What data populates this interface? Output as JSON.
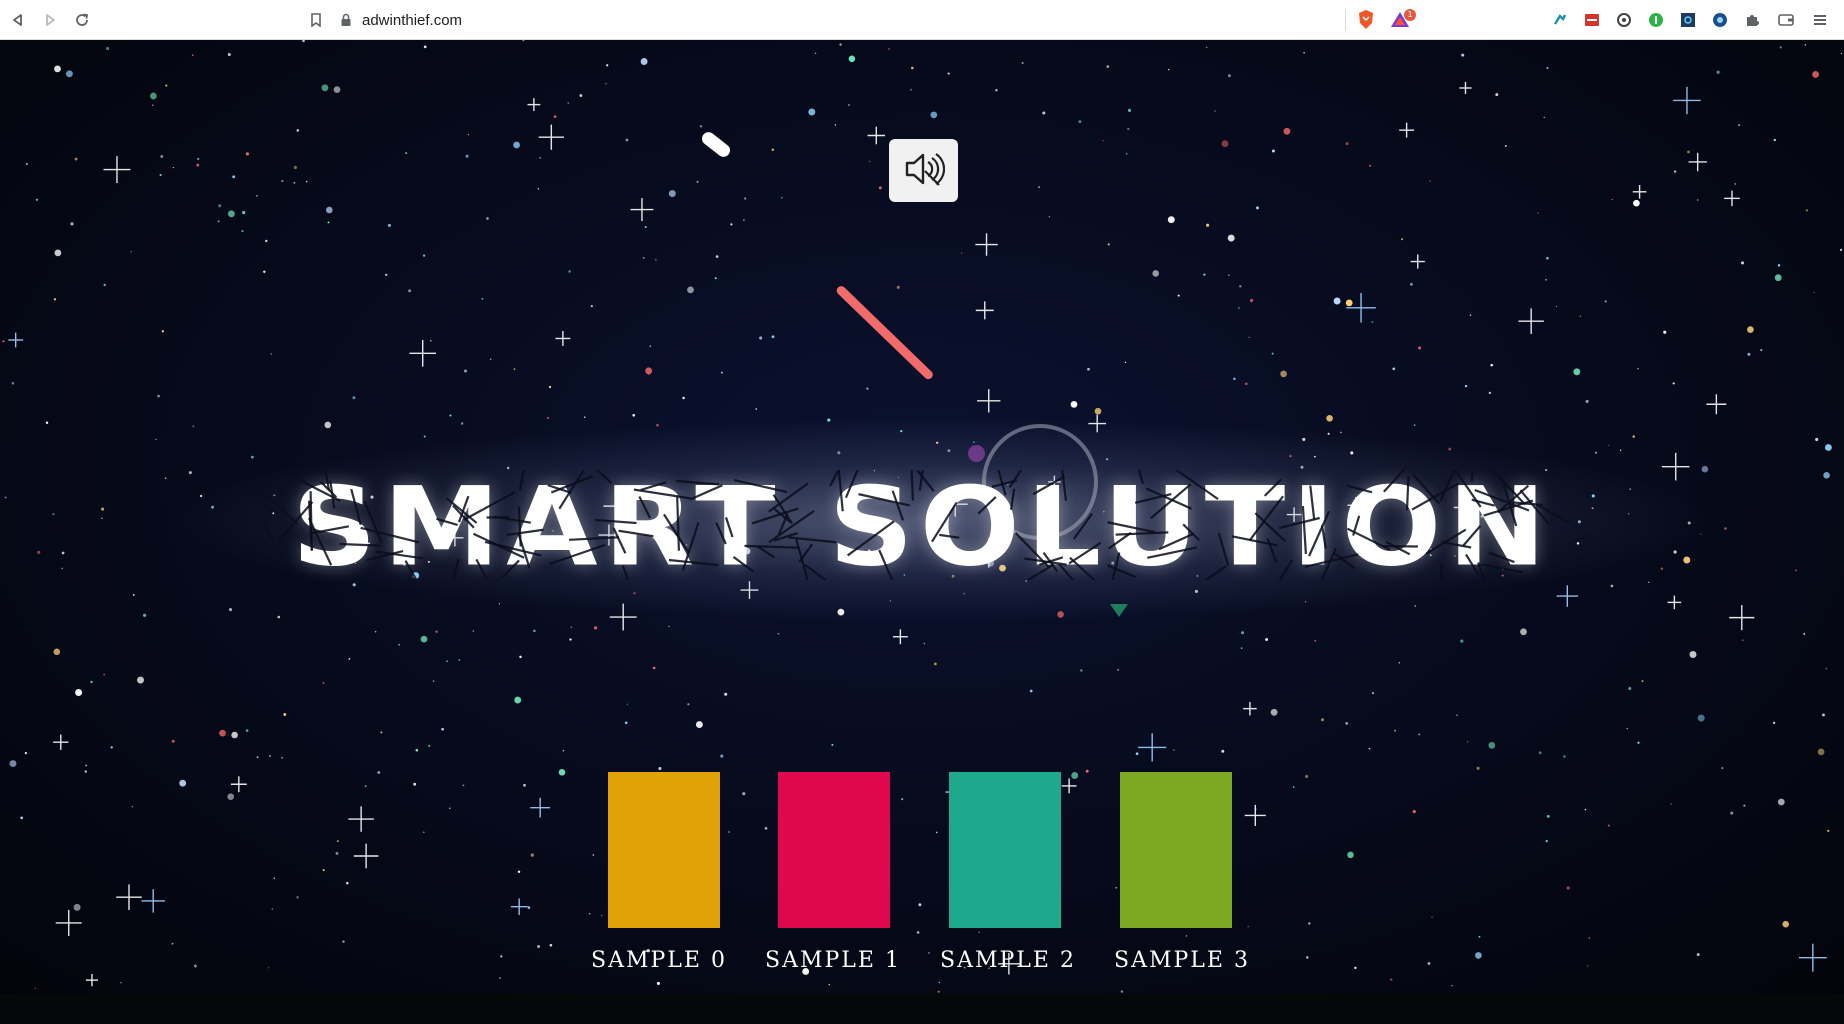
{
  "browser": {
    "url": "adwinthief.com",
    "back_icon": "back-arrow-icon",
    "forward_icon": "forward-arrow-icon",
    "reload_icon": "reload-icon",
    "bookmark_icon": "bookmark-icon",
    "rewards_badge": "1",
    "extensions": [
      "extension-icon-1",
      "extension-icon-2",
      "extension-icon-3",
      "extension-icon-4",
      "extension-icon-5",
      "extension-icon-6",
      "puzzle-icon",
      "wallet-icon",
      "menu-icon"
    ]
  },
  "hero": {
    "title": "SMART SOLUTION",
    "mute_icon": "speaker-muted-icon"
  },
  "samples": [
    {
      "label": "SAMPLE 0",
      "color": "#e0a206"
    },
    {
      "label": "SAMPLE 1",
      "color": "#e0074f"
    },
    {
      "label": "SAMPLE 2",
      "color": "#1ea98c"
    },
    {
      "label": "SAMPLE 3",
      "color": "#7da822"
    }
  ],
  "colors": {
    "background": "#05060c",
    "deco_line": "#f26b6b",
    "deco_dot": "#6b3a86",
    "deco_triangle": "#1f7d5c"
  }
}
